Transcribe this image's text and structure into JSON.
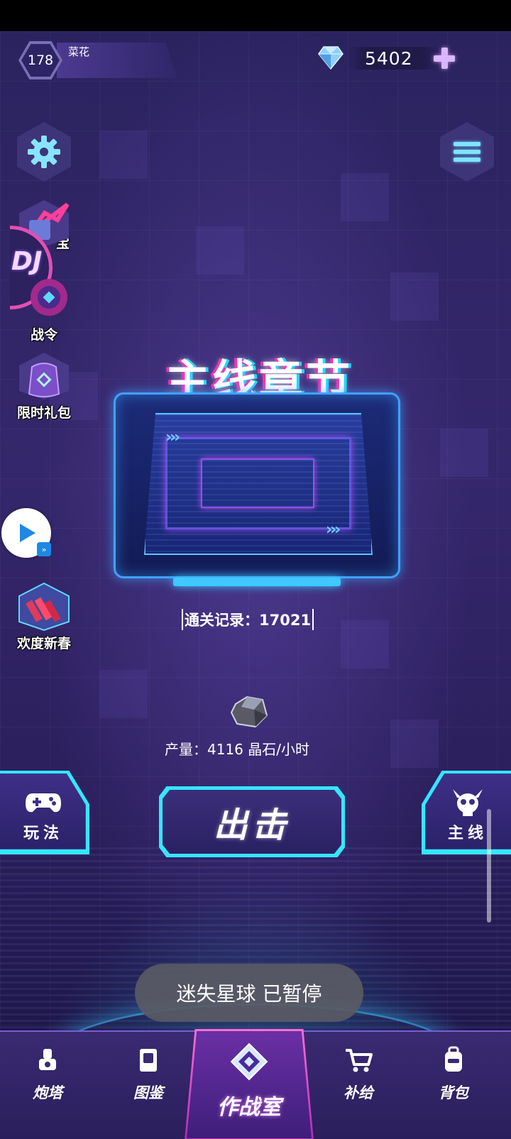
{
  "player": {
    "level": "178",
    "name": "菜花"
  },
  "currency": {
    "gems": "5402"
  },
  "side_events": [
    {
      "label": "宝"
    },
    {
      "label": "战令"
    },
    {
      "label": "限时礼包"
    },
    {
      "label": "欢度新春"
    }
  ],
  "badge": {
    "text": "DJ"
  },
  "chapter": {
    "title": "主线章节",
    "record": "通关记录：17021"
  },
  "production": {
    "text": "产量：4116 晶石/小时"
  },
  "actions": {
    "attack": "出击",
    "gameplay": "玩法",
    "main": "主线"
  },
  "toast": {
    "text": "迷失星球 已暂停"
  },
  "bottom_nav": {
    "turret": "炮塔",
    "codex": "图鉴",
    "command": "作战室",
    "supply": "补给",
    "backpack": "背包"
  },
  "colors": {
    "accent_cyan": "#35e6ff",
    "accent_pink": "#ff6fd6",
    "background": "#2b2360"
  },
  "icons": {
    "gem": "diamond-gem-icon",
    "settings": "gear-icon",
    "menu": "hamburger-icon",
    "gamepad": "gamepad-icon",
    "main": "skull-icon",
    "ore": "ore-crystal-icon"
  }
}
